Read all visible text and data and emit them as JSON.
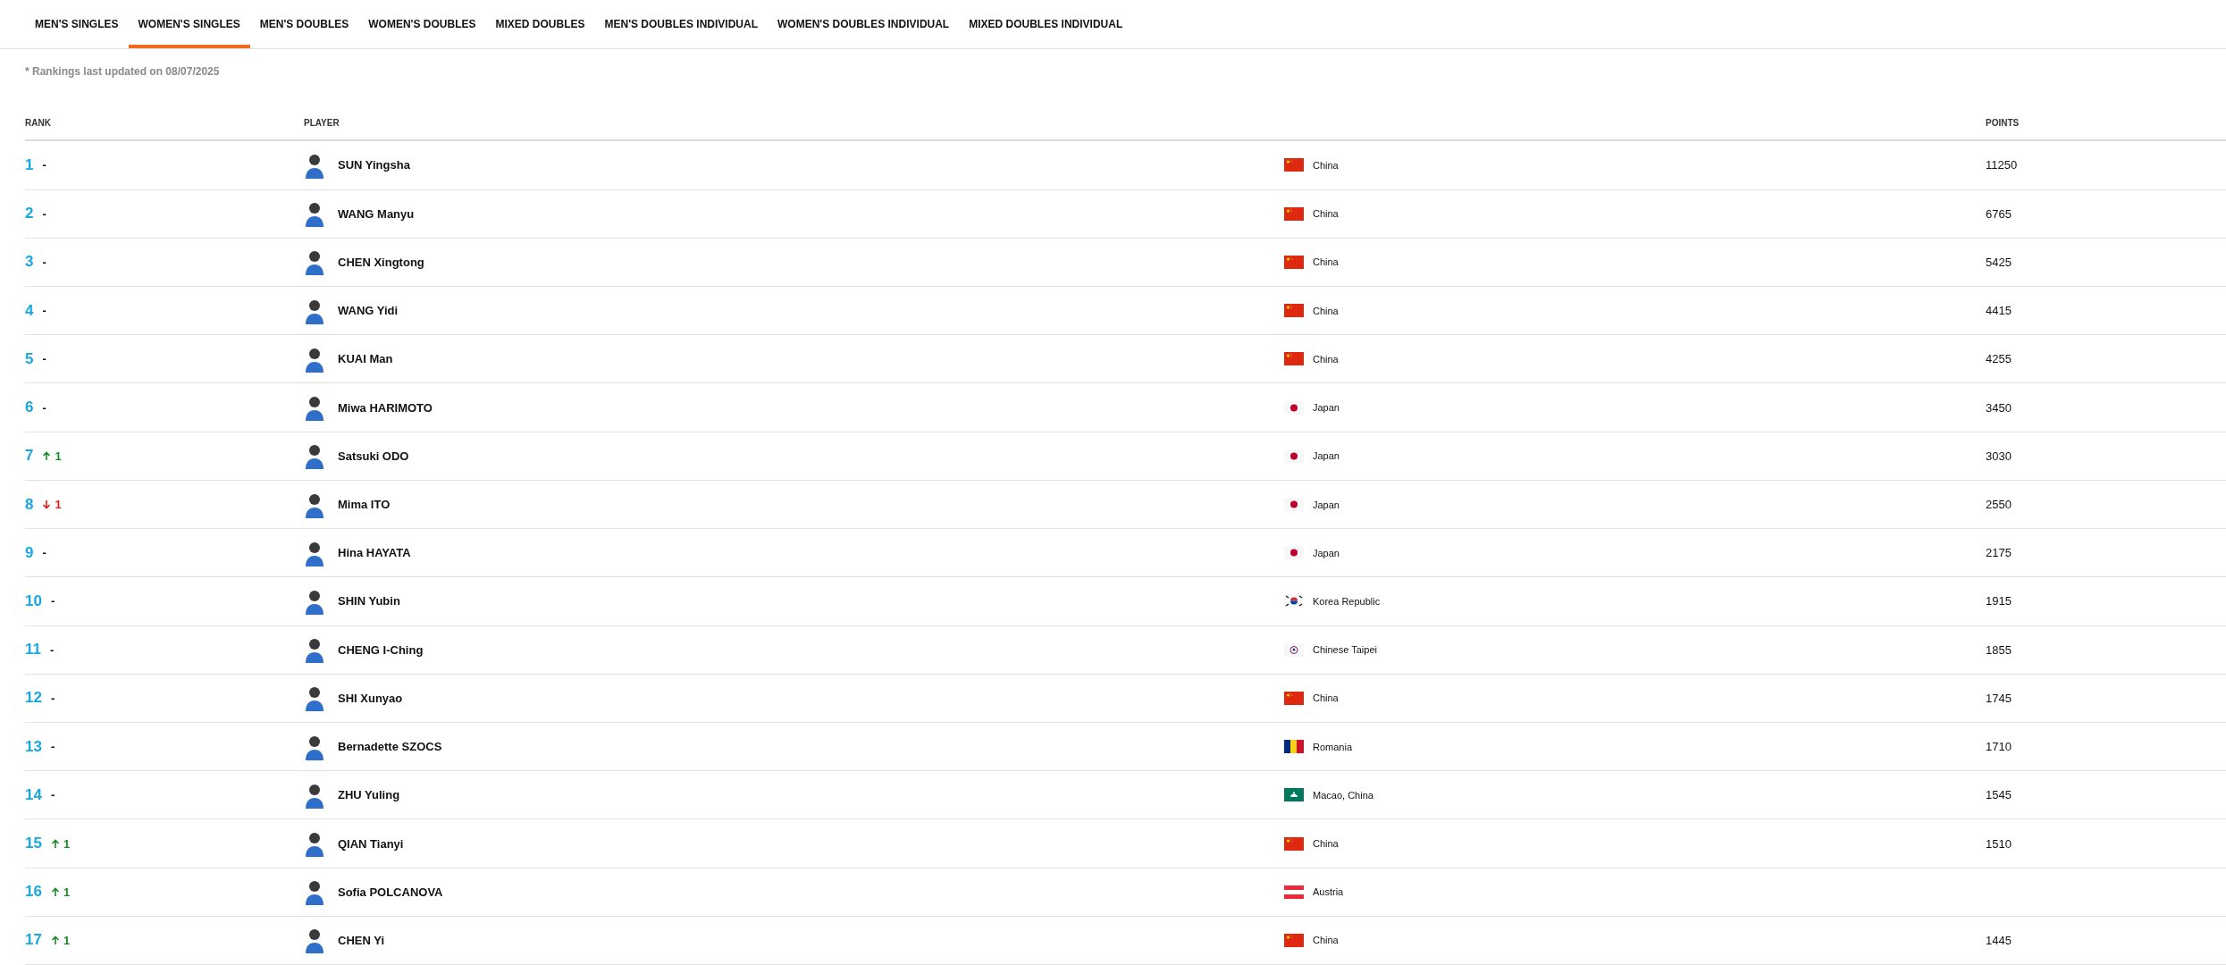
{
  "tabs": [
    {
      "label": "MEN'S SINGLES",
      "selected": false
    },
    {
      "label": "WOMEN'S SINGLES",
      "selected": true
    },
    {
      "label": "MEN'S DOUBLES",
      "selected": false
    },
    {
      "label": "WOMEN'S DOUBLES",
      "selected": false
    },
    {
      "label": "MIXED DOUBLES",
      "selected": false
    },
    {
      "label": "MEN'S DOUBLES INDIVIDUAL",
      "selected": false
    },
    {
      "label": "WOMEN'S DOUBLES INDIVIDUAL",
      "selected": false
    },
    {
      "label": "MIXED DOUBLES INDIVIDUAL",
      "selected": false
    }
  ],
  "note": "* Rankings last updated on 08/07/2025",
  "table": {
    "columns": {
      "rank": "RANK",
      "player": "PLAYER",
      "points": "POINTS"
    },
    "rows": [
      {
        "rank": "1",
        "movement": {
          "kind": "same",
          "text": "-"
        },
        "player": "SUN Yingsha",
        "flag": {
          "kind": "china"
        },
        "country": "China",
        "points": "11250"
      },
      {
        "rank": "2",
        "movement": {
          "kind": "same",
          "text": "-"
        },
        "player": "WANG Manyu",
        "flag": {
          "kind": "china"
        },
        "country": "China",
        "points": "6765"
      },
      {
        "rank": "3",
        "movement": {
          "kind": "same",
          "text": "-"
        },
        "player": "CHEN Xingtong",
        "flag": {
          "kind": "china"
        },
        "country": "China",
        "points": "5425"
      },
      {
        "rank": "4",
        "movement": {
          "kind": "same",
          "text": "-"
        },
        "player": "WANG Yidi",
        "flag": {
          "kind": "china"
        },
        "country": "China",
        "points": "4415"
      },
      {
        "rank": "5",
        "movement": {
          "kind": "same",
          "text": "-"
        },
        "player": "KUAI Man",
        "flag": {
          "kind": "china"
        },
        "country": "China",
        "points": "4255"
      },
      {
        "rank": "6",
        "movement": {
          "kind": "same",
          "text": "-"
        },
        "player": "Miwa HARIMOTO",
        "flag": {
          "kind": "japan"
        },
        "country": "Japan",
        "points": "3450"
      },
      {
        "rank": "7",
        "movement": {
          "kind": "up",
          "text": "1"
        },
        "player": "Satsuki ODO",
        "flag": {
          "kind": "japan"
        },
        "country": "Japan",
        "points": "3030"
      },
      {
        "rank": "8",
        "movement": {
          "kind": "down",
          "text": "1"
        },
        "player": "Mima ITO",
        "flag": {
          "kind": "japan"
        },
        "country": "Japan",
        "points": "2550"
      },
      {
        "rank": "9",
        "movement": {
          "kind": "same",
          "text": "-"
        },
        "player": "Hina HAYATA",
        "flag": {
          "kind": "japan"
        },
        "country": "Japan",
        "points": "2175"
      },
      {
        "rank": "10",
        "movement": {
          "kind": "same",
          "text": "-"
        },
        "player": "SHIN Yubin",
        "flag": {
          "kind": "korea"
        },
        "country": "Korea Republic",
        "points": "1915"
      },
      {
        "rank": "11",
        "movement": {
          "kind": "same",
          "text": "-"
        },
        "player": "CHENG I-Ching",
        "flag": {
          "kind": "taipei"
        },
        "country": "Chinese Taipei",
        "points": "1855"
      },
      {
        "rank": "12",
        "movement": {
          "kind": "same",
          "text": "-"
        },
        "player": "SHI Xunyao",
        "flag": {
          "kind": "china"
        },
        "country": "China",
        "points": "1745"
      },
      {
        "rank": "13",
        "movement": {
          "kind": "same",
          "text": "-"
        },
        "player": "Bernadette SZOCS",
        "flag": {
          "kind": "romania"
        },
        "country": "Romania",
        "points": "1710"
      },
      {
        "rank": "14",
        "movement": {
          "kind": "same",
          "text": "-"
        },
        "player": "ZHU Yuling",
        "flag": {
          "kind": "macao"
        },
        "country": "Macao, China",
        "points": "1545"
      },
      {
        "rank": "15",
        "movement": {
          "kind": "up",
          "text": "1"
        },
        "player": "QIAN Tianyi",
        "flag": {
          "kind": "china"
        },
        "country": "China",
        "points": "1510"
      },
      {
        "rank": "16",
        "movement": {
          "kind": "up",
          "text": "1"
        },
        "player": "Sofia POLCANOVA",
        "flag": {
          "kind": "austria"
        },
        "country": "Austria"
      },
      {
        "rank": "17",
        "movement": {
          "kind": "up",
          "text": "1"
        },
        "player": "CHEN Yi",
        "flag": {
          "kind": "china"
        },
        "country": "China",
        "points": "1445"
      }
    ]
  }
}
